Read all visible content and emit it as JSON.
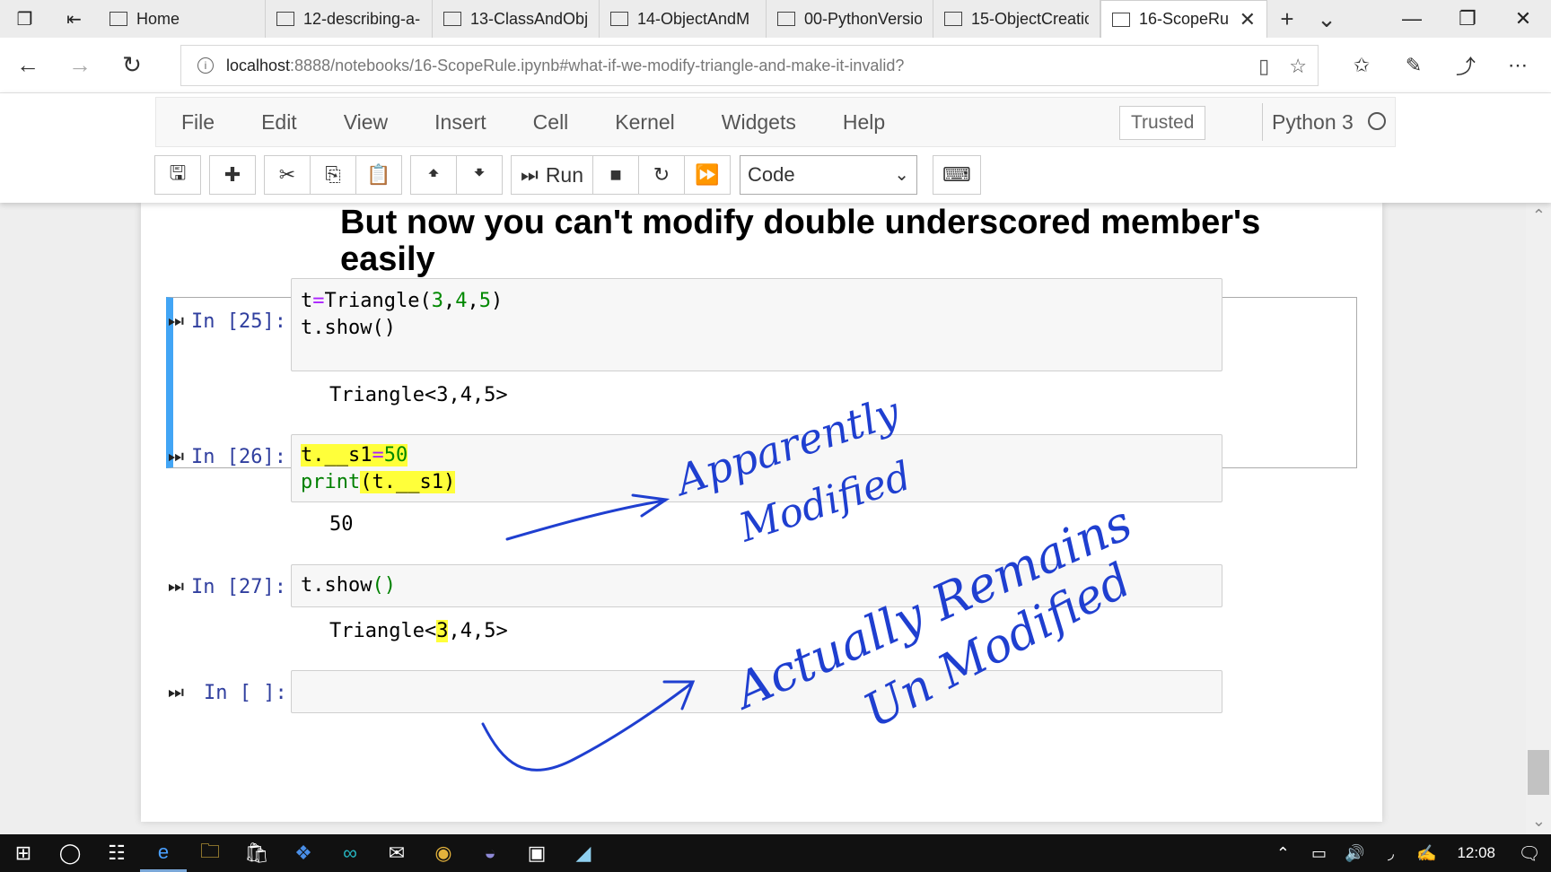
{
  "browser": {
    "tabs": [
      {
        "label": "Home",
        "active": false
      },
      {
        "label": "12-describing-a-",
        "active": false
      },
      {
        "label": "13-ClassAndObj",
        "active": false
      },
      {
        "label": "14-ObjectAndM",
        "active": false
      },
      {
        "label": "00-PythonVersio",
        "active": false
      },
      {
        "label": "15-ObjectCreatio",
        "active": false
      },
      {
        "label": "16-ScopeRu",
        "active": true
      }
    ],
    "url_host": "localhost",
    "url_path": ":8888/notebooks/16-ScopeRule.ipynb#what-if-we-modify-triangle-and-make-it-invalid?"
  },
  "menu": [
    "File",
    "Edit",
    "View",
    "Insert",
    "Cell",
    "Kernel",
    "Widgets",
    "Help"
  ],
  "status": {
    "trusted": "Trusted",
    "kernel": "Python 3"
  },
  "toolbar": {
    "run_label": "Run",
    "cell_type": "Code"
  },
  "notebook": {
    "heading": "But now you can't modify double underscored member's easily",
    "cells": [
      {
        "prompt": "In [25]:",
        "output": "Triangle<3,4,5>"
      },
      {
        "prompt": "In [26]:",
        "output": "50"
      },
      {
        "prompt": "In [27]:",
        "output": "Triangle<3,4,5>"
      },
      {
        "prompt": "In [ ]:",
        "output": ""
      }
    ],
    "code": {
      "c25_l1_var": "t",
      "c25_l1_eq": "=",
      "c25_l1_fn": "Triangle(",
      "c25_l1_a": "3",
      "c25_l1_b": "4",
      "c25_l1_c": "5",
      "c25_l1_end": ")",
      "c25_l2": "t.show()",
      "c26_l1_lhs": "t.__s1",
      "c26_l1_eq": "=",
      "c26_l1_val": "50",
      "c26_l2_fn": "print",
      "c26_l2_arg": "(t.__s1)",
      "c27_l1_obj": "t.show",
      "c27_l1_par": "()"
    },
    "output27_parts": {
      "pre": "Triangle<",
      "hl": "3",
      "post": ",4,5>"
    }
  },
  "annotations": {
    "note1_line1": "Apparently",
    "note1_line2": "Modified",
    "note2_line1": "Actually Remains",
    "note2_line2": "Un Modified",
    "ink_color": "#1f3fd0"
  },
  "taskbar": {
    "time": "12:08"
  }
}
